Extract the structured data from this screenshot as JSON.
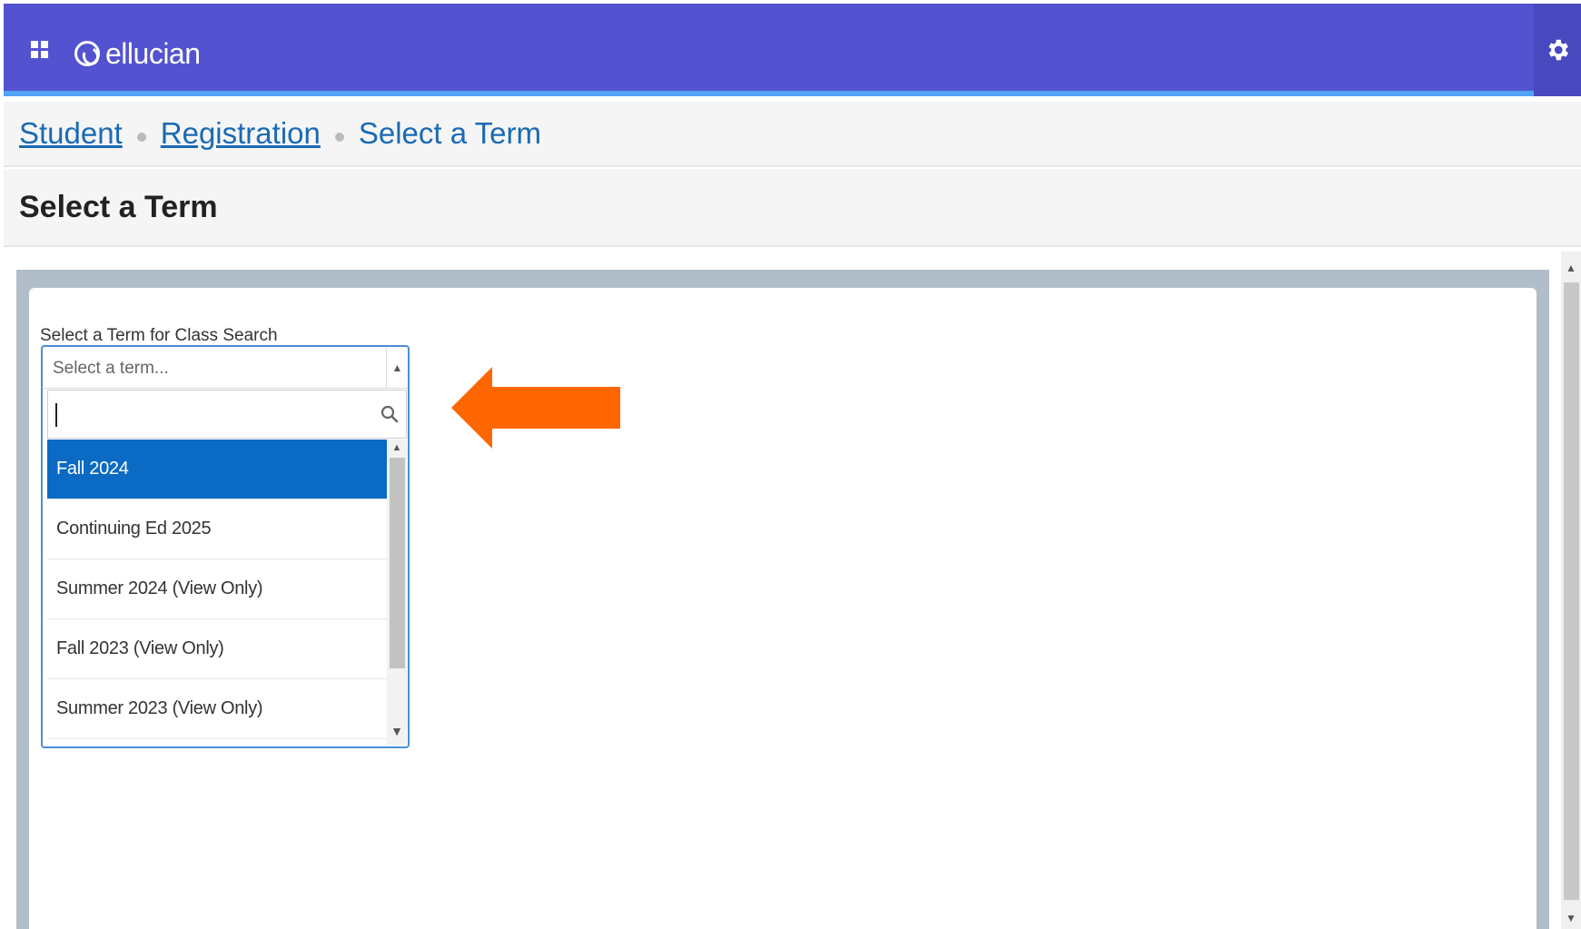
{
  "header": {
    "logo_text": "ellucian",
    "bar_color": "#5353d1",
    "accent_line_color": "#51a3f5",
    "apps_icon": "grid-apps-icon",
    "settings_icon": "gear-icon"
  },
  "breadcrumb": {
    "items": [
      {
        "label": "Student",
        "link": true
      },
      {
        "label": "Registration",
        "link": true
      },
      {
        "label": "Select a Term",
        "link": false
      }
    ]
  },
  "page": {
    "title": "Select a Term"
  },
  "term_select": {
    "label": "Select a Term for Class Search",
    "placeholder": "Select a term...",
    "search_value": "",
    "search_icon": "magnifier-icon",
    "options": [
      {
        "label": "Fall 2024",
        "selected": true
      },
      {
        "label": "Continuing Ed 2025",
        "selected": false
      },
      {
        "label": "Summer 2024 (View Only)",
        "selected": false
      },
      {
        "label": "Fall 2023 (View Only)",
        "selected": false
      },
      {
        "label": "Summer 2023 (View Only)",
        "selected": false
      }
    ],
    "selected_color": "#0a6ac4"
  },
  "annotation": {
    "arrow_color": "#ff6600",
    "arrow_icon": "left-arrow-icon"
  }
}
